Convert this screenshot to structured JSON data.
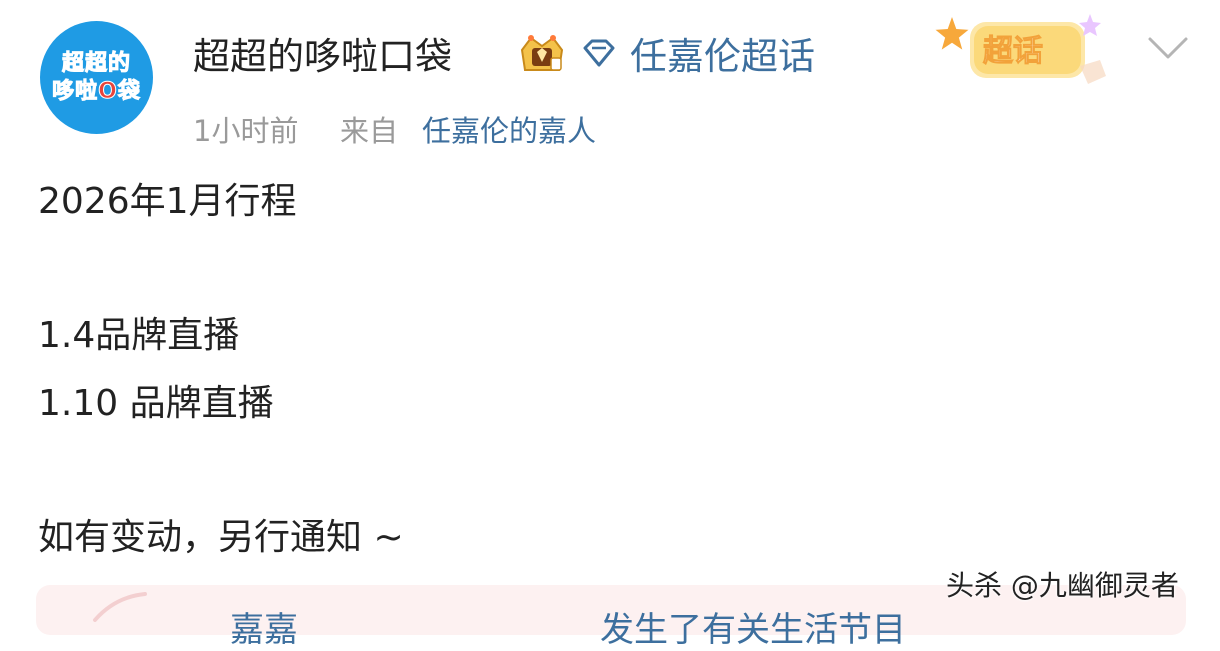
{
  "user": {
    "name": "超超的哆啦口袋",
    "avatar_text_line1": "超超的",
    "avatar_text_line2": "哆啦O袋",
    "avatar_bg": "#1f9be4"
  },
  "topic": {
    "label": "任嘉伦超话",
    "icon": "diamond-icon"
  },
  "badge": {
    "label": "超话",
    "icon": "star-icon"
  },
  "meta": {
    "time": "1小时前",
    "from_label": "来自",
    "source": "任嘉伦的嘉人"
  },
  "post": {
    "lines": [
      "2026年1月行程",
      "1.4品牌直播",
      "1.10 品牌直播",
      "如有变动，另行通知 ~"
    ]
  },
  "repost": {
    "text_left": "嘉嘉",
    "text_right": "发生了有关生活节目"
  },
  "watermark": "头杀 @九幽御灵者",
  "colors": {
    "link": "#3d6f9e",
    "muted": "#9a9a9a",
    "text": "#222222",
    "card_bg": "#fdf1f1"
  }
}
